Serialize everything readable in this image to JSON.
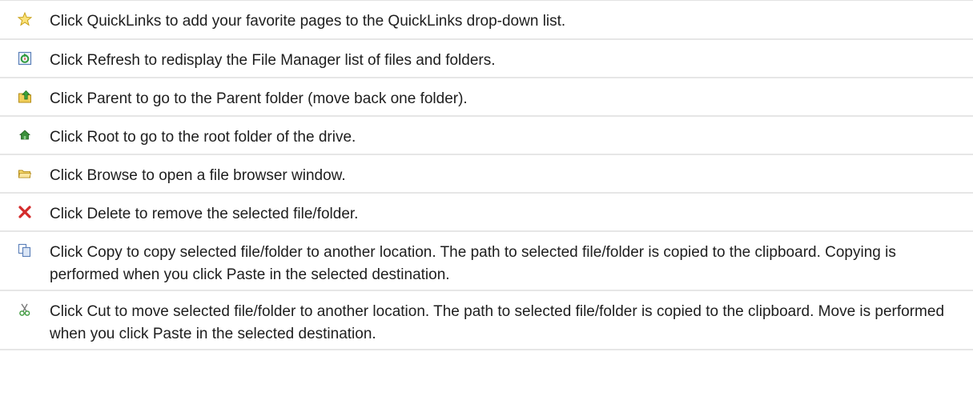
{
  "rows": [
    {
      "icon": "star-icon",
      "text": "Click QuickLinks to add your favorite pages to the QuickLinks drop-down list."
    },
    {
      "icon": "refresh-icon",
      "text": "Click Refresh to redisplay the File Manager list of files and folders."
    },
    {
      "icon": "parent-folder-icon",
      "text": "Click Parent to go to the Parent folder (move back one folder)."
    },
    {
      "icon": "root-folder-icon",
      "text": "Click Root to go to the root folder of the drive."
    },
    {
      "icon": "browse-folder-icon",
      "text": "Click Browse to open a file browser window."
    },
    {
      "icon": "delete-icon",
      "text": "Click Delete to remove the selected file/folder."
    },
    {
      "icon": "copy-icon",
      "text": "Click Copy to copy selected file/folder to another location. The path to selected file/folder is copied to the clipboard. Copying is performed when you click Paste in the selected destination."
    },
    {
      "icon": "cut-icon",
      "text": "Click Cut to move selected file/folder to another location. The path to selected file/folder is copied to the clipboard. Move is performed when you click Paste in the selected destination."
    }
  ],
  "colors": {
    "divider": "#e6e6e6",
    "text": "#1e1e1e",
    "delete_red": "#d42b2b",
    "star_yellow": "#f5d142"
  }
}
